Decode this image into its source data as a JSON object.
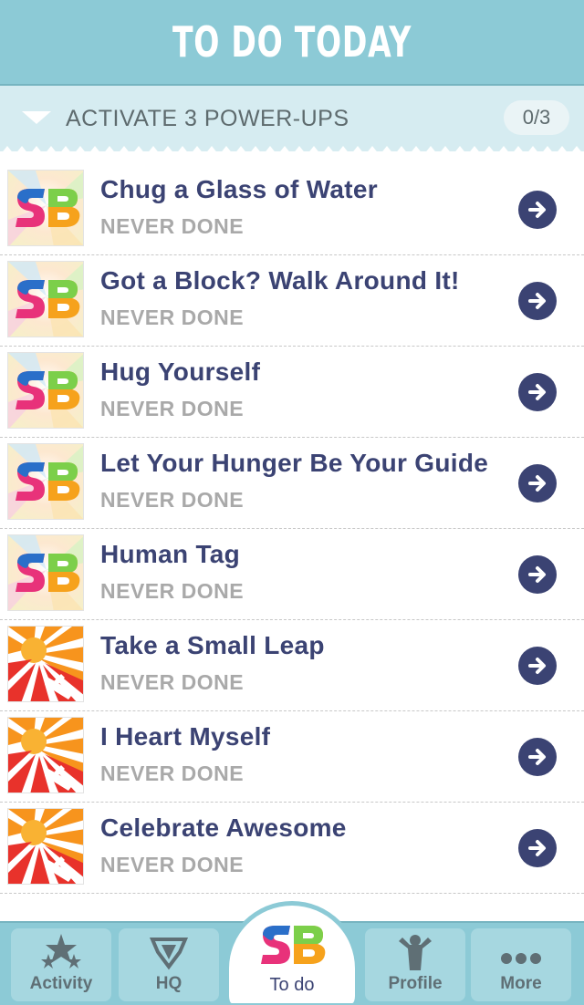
{
  "header": {
    "title": "TO DO TODAY"
  },
  "section": {
    "label": "ACTIVATE 3 POWER-UPS",
    "count": "0/3"
  },
  "items": [
    {
      "name": "Chug a Glass of Water",
      "status": "NEVER DONE",
      "icon": "sb-logo-icon"
    },
    {
      "name": "Got a Block? Walk Around It!",
      "status": "NEVER DONE",
      "icon": "sb-logo-icon"
    },
    {
      "name": "Hug Yourself",
      "status": "NEVER DONE",
      "icon": "sb-logo-icon"
    },
    {
      "name": "Let Your Hunger Be Your Guide",
      "status": "NEVER DONE",
      "icon": "sb-logo-icon"
    },
    {
      "name": "Human Tag",
      "status": "NEVER DONE",
      "icon": "sb-logo-icon"
    },
    {
      "name": "Take a Small Leap",
      "status": "NEVER DONE",
      "icon": "sunburst-flag-icon"
    },
    {
      "name": "I Heart Myself",
      "status": "NEVER DONE",
      "icon": "sunburst-flag-icon"
    },
    {
      "name": "Celebrate Awesome",
      "status": "NEVER DONE",
      "icon": "sunburst-flag-icon"
    }
  ],
  "tabs": [
    {
      "label": "Activity",
      "icon": "stars-icon"
    },
    {
      "label": "HQ",
      "icon": "emblem-icon"
    },
    {
      "label": "To do",
      "icon": "sb-logo-icon"
    },
    {
      "label": "Profile",
      "icon": "person-icon"
    },
    {
      "label": "More",
      "icon": "dots-icon"
    }
  ],
  "colors": {
    "header": "#8ccad6",
    "accent": "#3b4373",
    "muted": "#a9a9a9"
  }
}
